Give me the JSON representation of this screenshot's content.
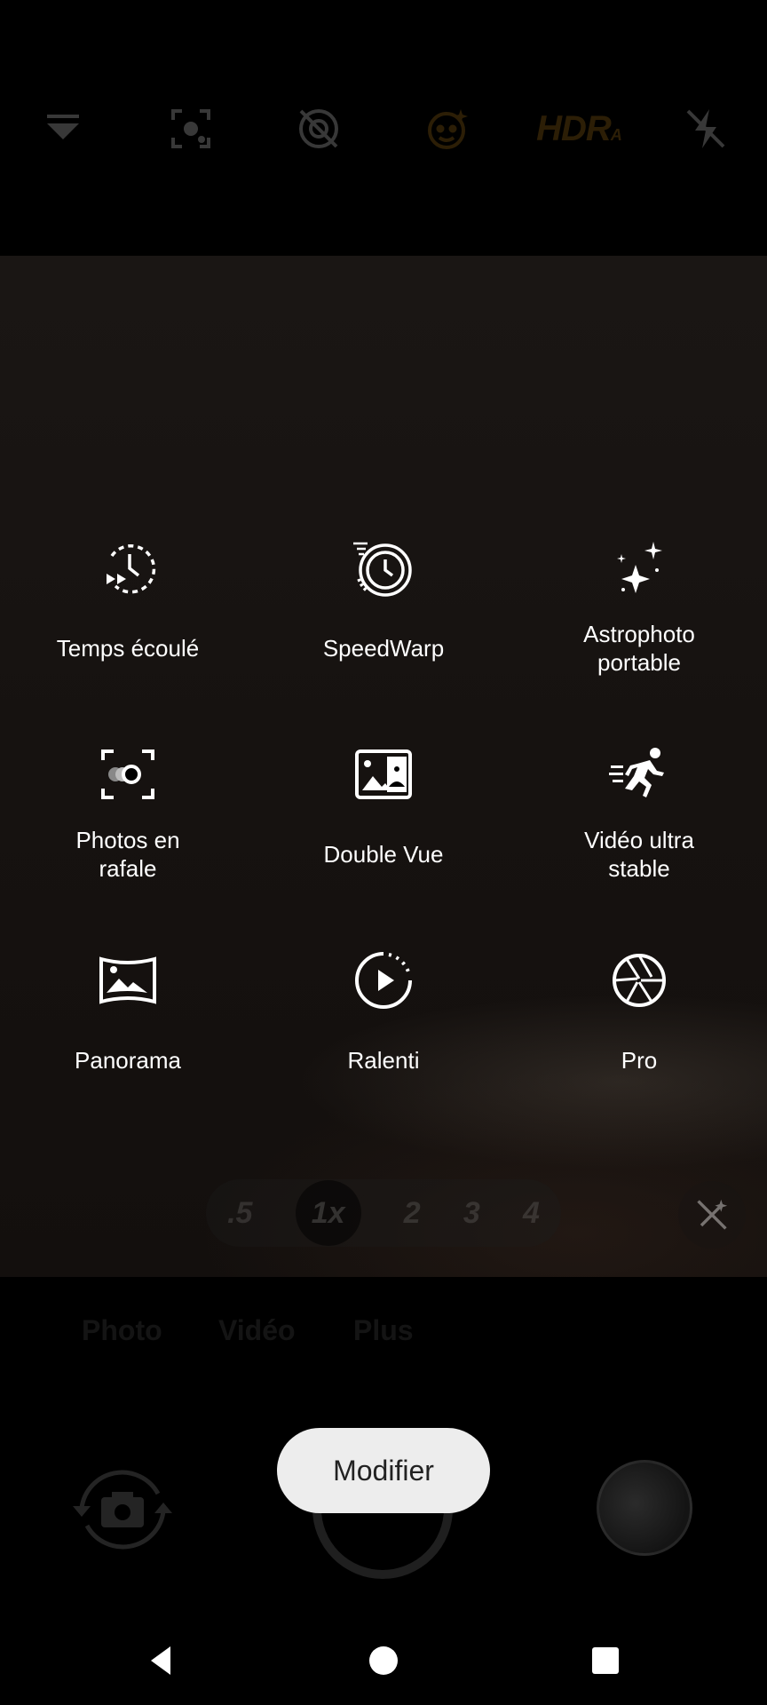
{
  "top_bar": {
    "icons": [
      "collapse-icon",
      "focus-icon",
      "motion-off-icon",
      "face-beauty-icon",
      "hdr-icon",
      "flash-off-icon"
    ],
    "hdr_label": "HDR",
    "hdr_suffix": "A"
  },
  "modes": [
    {
      "label": "Temps écoulé",
      "icon": "timelapse-icon"
    },
    {
      "label": "SpeedWarp",
      "icon": "speedwarp-icon"
    },
    {
      "label": "Astrophoto\nportable",
      "icon": "sparkles-icon"
    },
    {
      "label": "Photos en\nrafale",
      "icon": "burst-icon"
    },
    {
      "label": "Double Vue",
      "icon": "dual-view-icon"
    },
    {
      "label": "Vidéo ultra\nstable",
      "icon": "running-icon"
    },
    {
      "label": "Panorama",
      "icon": "panorama-icon"
    },
    {
      "label": "Ralenti",
      "icon": "slow-motion-icon"
    },
    {
      "label": "Pro",
      "icon": "aperture-icon"
    }
  ],
  "zoom": {
    "levels": [
      ".5",
      "1x",
      "2",
      "3",
      "4"
    ],
    "active": "1x"
  },
  "mode_tabs": [
    "Photo",
    "Vidéo",
    "Plus"
  ],
  "modify_button": "Modifier",
  "colors": {
    "background": "#000000",
    "label": "#ffffff",
    "button_bg": "#ededed",
    "accent_hdr": "#c9881c"
  }
}
